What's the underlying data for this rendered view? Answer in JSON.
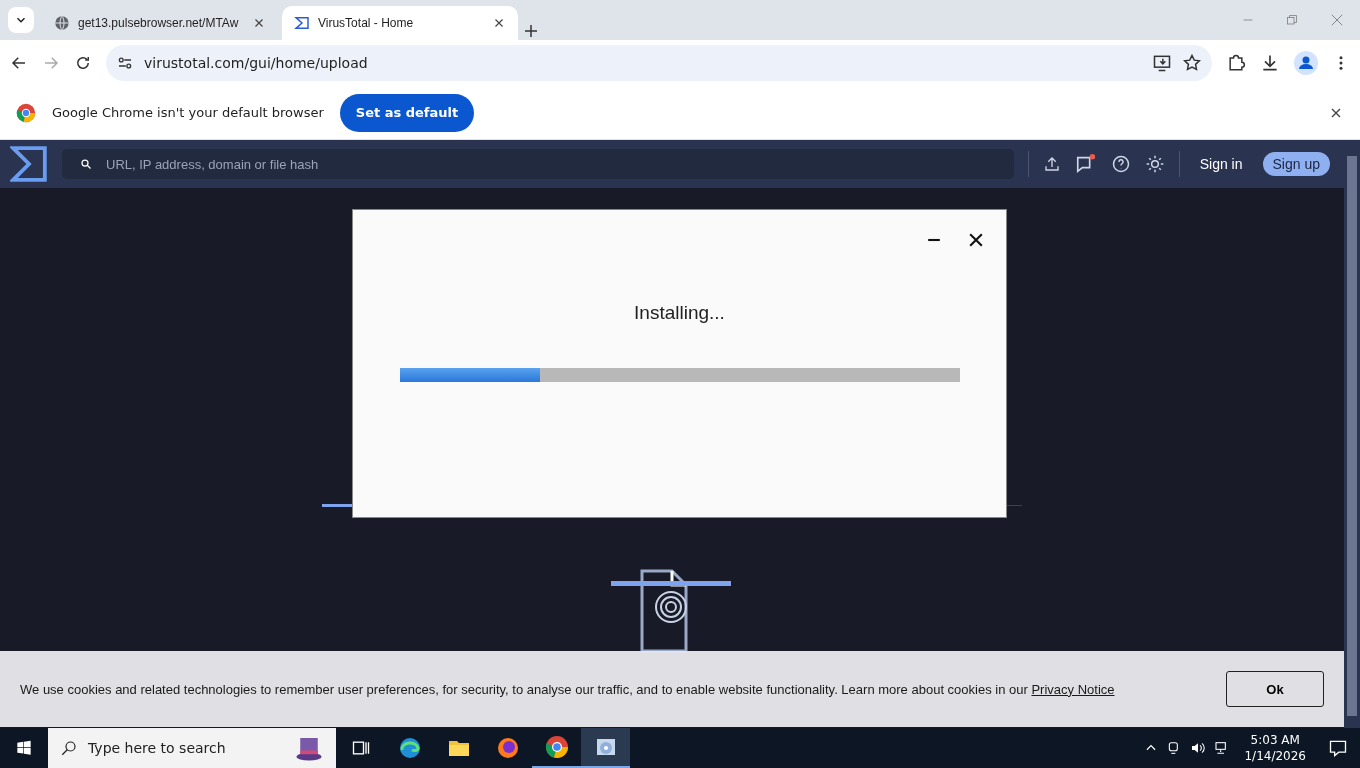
{
  "browser": {
    "tabs": [
      {
        "title": "get13.pulsebrowser.net/MTAw",
        "selected": false
      },
      {
        "title": "VirusTotal - Home",
        "selected": true
      }
    ],
    "address": "virustotal.com/gui/home/upload"
  },
  "infobar": {
    "message": "Google Chrome isn't your default browser",
    "button": "Set as default"
  },
  "site": {
    "search_placeholder": "URL, IP address, domain or file hash",
    "sign_in": "Sign in",
    "sign_up": "Sign up"
  },
  "installer": {
    "status": "Installing...",
    "level": 0.25
  },
  "cookie": {
    "text": "We use cookies and related technologies to remember user preferences, for security, to analyse our traffic, and to enable website functionality. Learn more about cookies in our ",
    "link": "Privacy Notice",
    "button": "Ok"
  },
  "taskbar": {
    "search_placeholder": "Type here to search",
    "time": "5:03 AM",
    "date": "1/14/2026"
  }
}
